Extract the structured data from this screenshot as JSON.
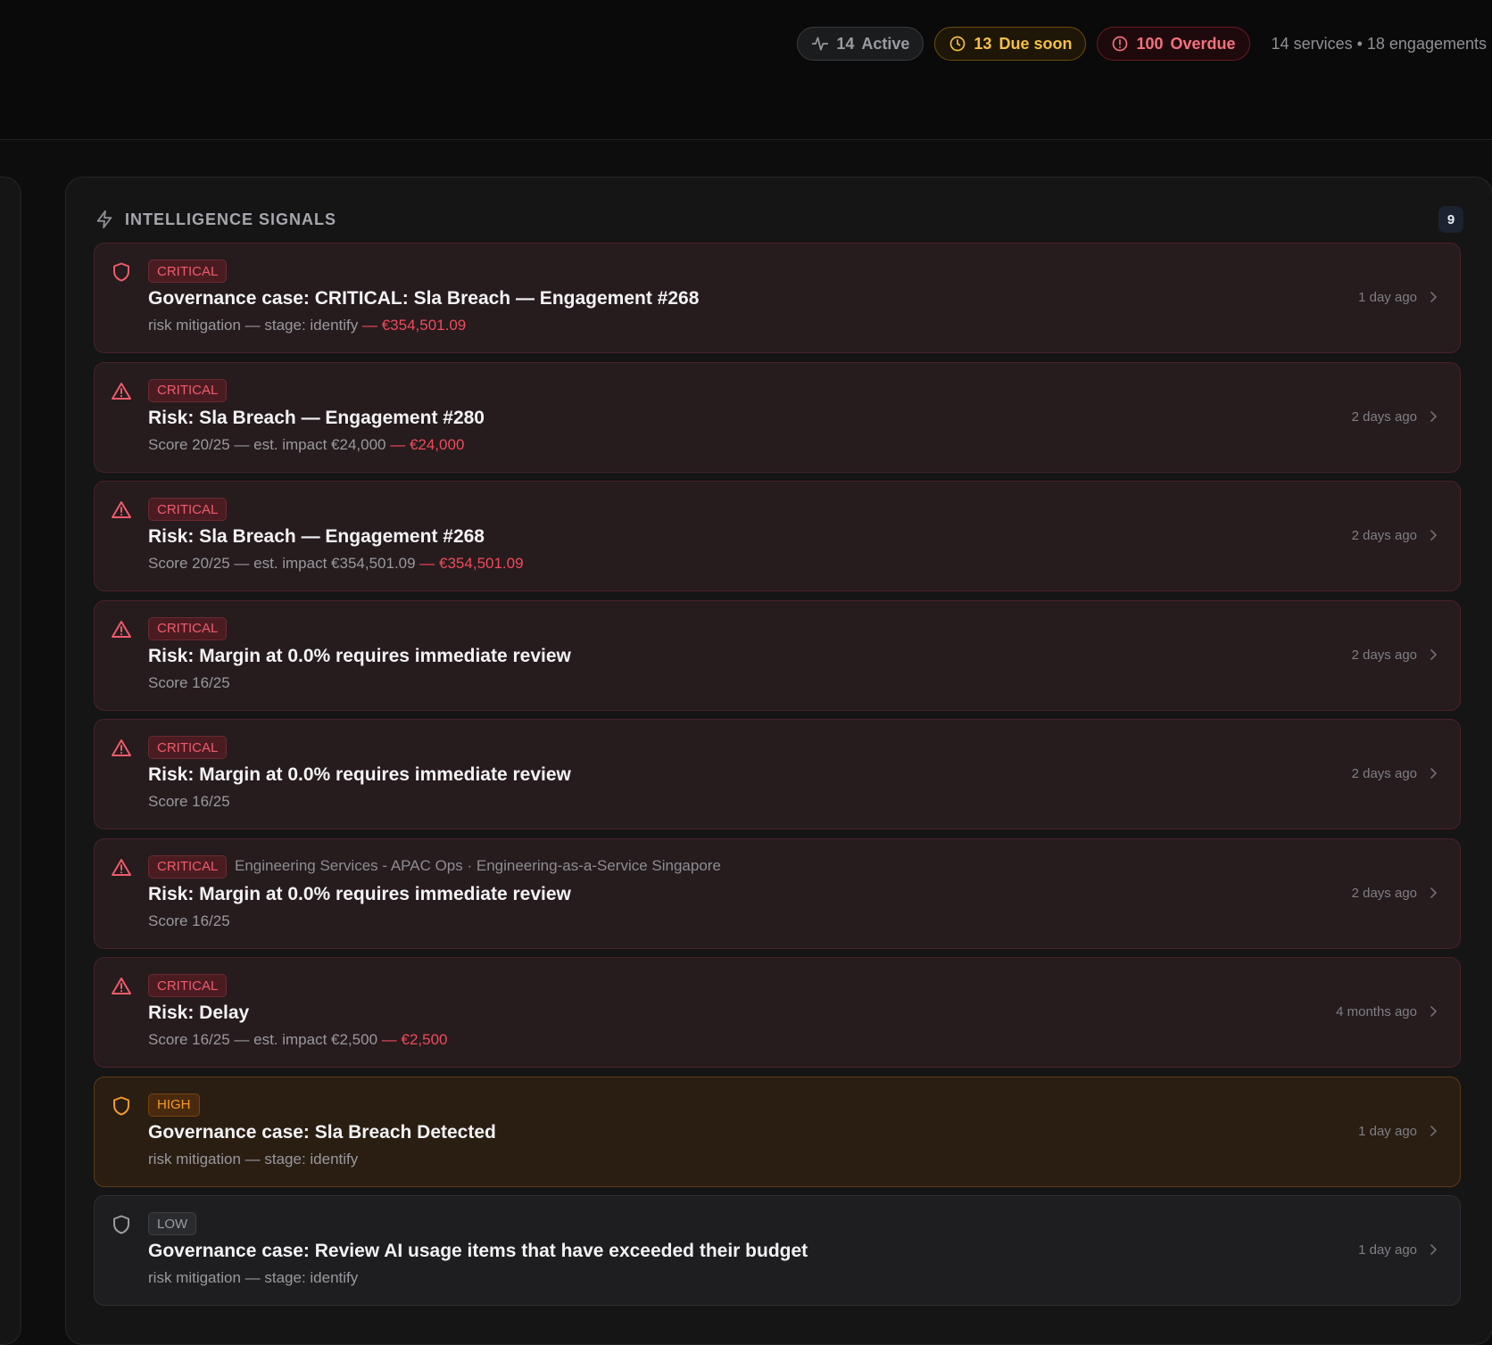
{
  "header": {
    "active": {
      "count": "14",
      "label": "Active"
    },
    "due_soon": {
      "count": "13",
      "label": "Due soon"
    },
    "overdue": {
      "count": "100",
      "label": "Overdue"
    },
    "summary": "14 services • 18 engagements"
  },
  "panel": {
    "title": "INTELLIGENCE SIGNALS",
    "count": "9",
    "signals": [
      {
        "severity": "CRITICAL",
        "icon": "shield-icon",
        "context": "",
        "title": "Governance case: CRITICAL: Sla Breach — Engagement #268",
        "detail": "risk mitigation — stage: identify",
        "amount": " — €354,501.09",
        "time": "1 day ago"
      },
      {
        "severity": "CRITICAL",
        "icon": "warning-icon",
        "context": "",
        "title": "Risk: Sla Breach — Engagement #280",
        "detail": "Score 20/25 — est. impact €24,000",
        "amount": " — €24,000",
        "time": "2 days ago"
      },
      {
        "severity": "CRITICAL",
        "icon": "warning-icon",
        "context": "",
        "title": "Risk: Sla Breach — Engagement #268",
        "detail": "Score 20/25 — est. impact €354,501.09",
        "amount": " — €354,501.09",
        "time": "2 days ago"
      },
      {
        "severity": "CRITICAL",
        "icon": "warning-icon",
        "context": "",
        "title": "Risk: Margin at 0.0% requires immediate review",
        "detail": "Score 16/25",
        "amount": "",
        "time": "2 days ago"
      },
      {
        "severity": "CRITICAL",
        "icon": "warning-icon",
        "context": "",
        "title": "Risk: Margin at 0.0% requires immediate review",
        "detail": "Score 16/25",
        "amount": "",
        "time": "2 days ago"
      },
      {
        "severity": "CRITICAL",
        "icon": "warning-icon",
        "context": "Engineering Services - APAC Ops · Engineering-as-a-Service Singapore",
        "title": "Risk: Margin at 0.0% requires immediate review",
        "detail": "Score 16/25",
        "amount": "",
        "time": "2 days ago"
      },
      {
        "severity": "CRITICAL",
        "icon": "warning-icon",
        "context": "",
        "title": "Risk: Delay",
        "detail": "Score 16/25 — est. impact €2,500",
        "amount": " — €2,500",
        "time": "4 months ago"
      },
      {
        "severity": "HIGH",
        "icon": "shield-icon",
        "context": "",
        "title": "Governance case: Sla Breach Detected",
        "detail": "risk mitigation — stage: identify",
        "amount": "",
        "time": "1 day ago"
      },
      {
        "severity": "LOW",
        "icon": "shield-icon",
        "context": "",
        "title": "Governance case: Review AI usage items that have exceeded their budget",
        "detail": "risk mitigation — stage: identify",
        "amount": "",
        "time": "1 day ago"
      }
    ]
  },
  "colors": {
    "critical": "#f05b6b",
    "high": "#f59a2a",
    "low": "#9c9da2",
    "due_soon": "#f5c044",
    "overdue": "#f6707e"
  }
}
